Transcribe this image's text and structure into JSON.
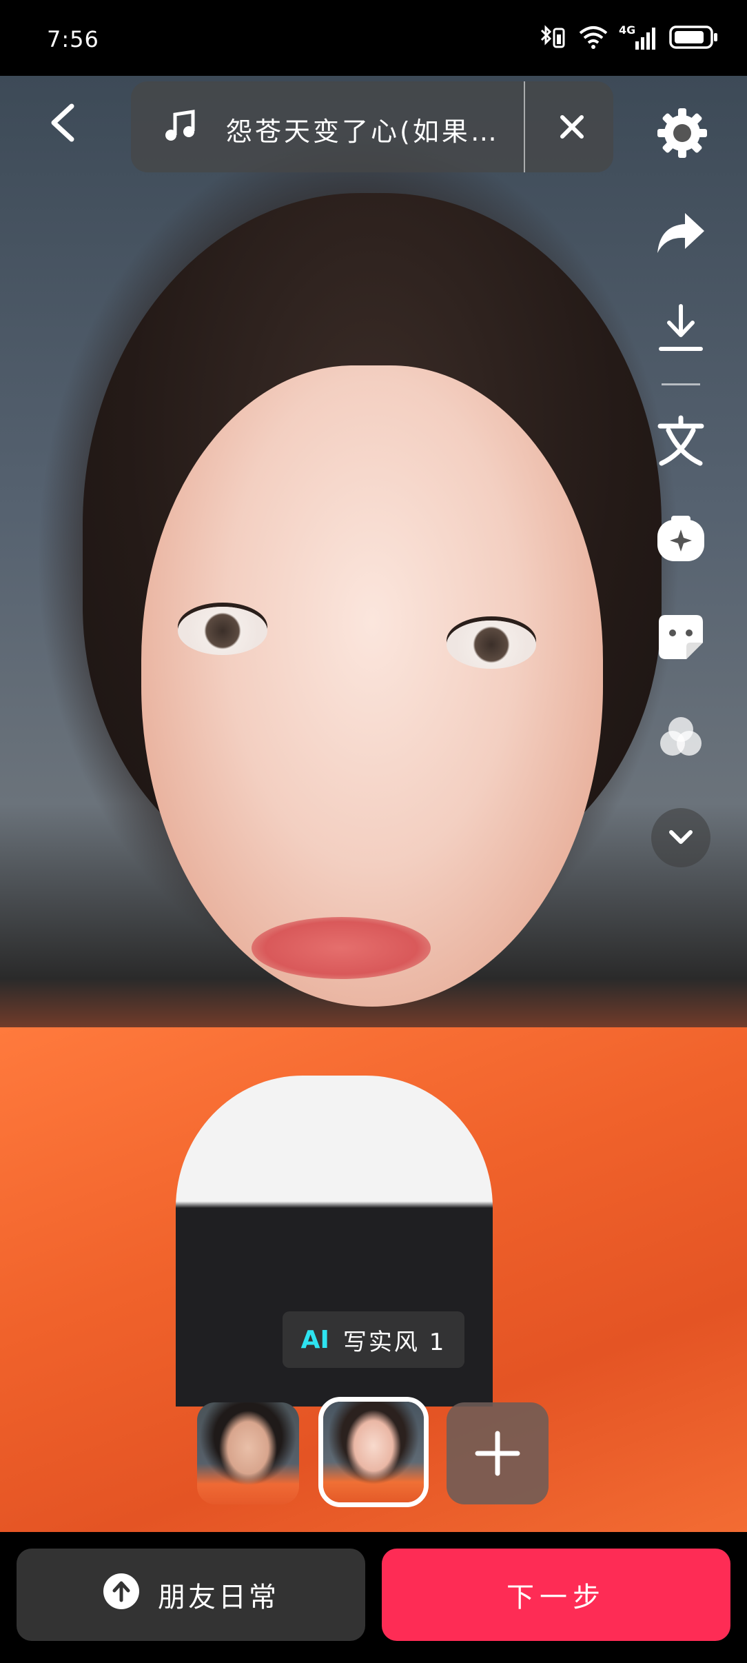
{
  "status_bar": {
    "time": "7:56",
    "network_label": "4G"
  },
  "top_bar": {
    "music_title": "怨苍天变了心(如果…"
  },
  "side_tools": {
    "icons": [
      "share-icon",
      "download-icon",
      "text-icon",
      "effects-icon",
      "sticker-icon",
      "filter-icon",
      "chevron-down-icon"
    ]
  },
  "style_label": {
    "badge": "AI",
    "name": "写实风 1"
  },
  "bottom_actions": {
    "daily_label": "朋友日常",
    "next_label": "下一步"
  },
  "colors": {
    "accent": "#fe2c55",
    "ai_badge": "#2ee3f0"
  }
}
